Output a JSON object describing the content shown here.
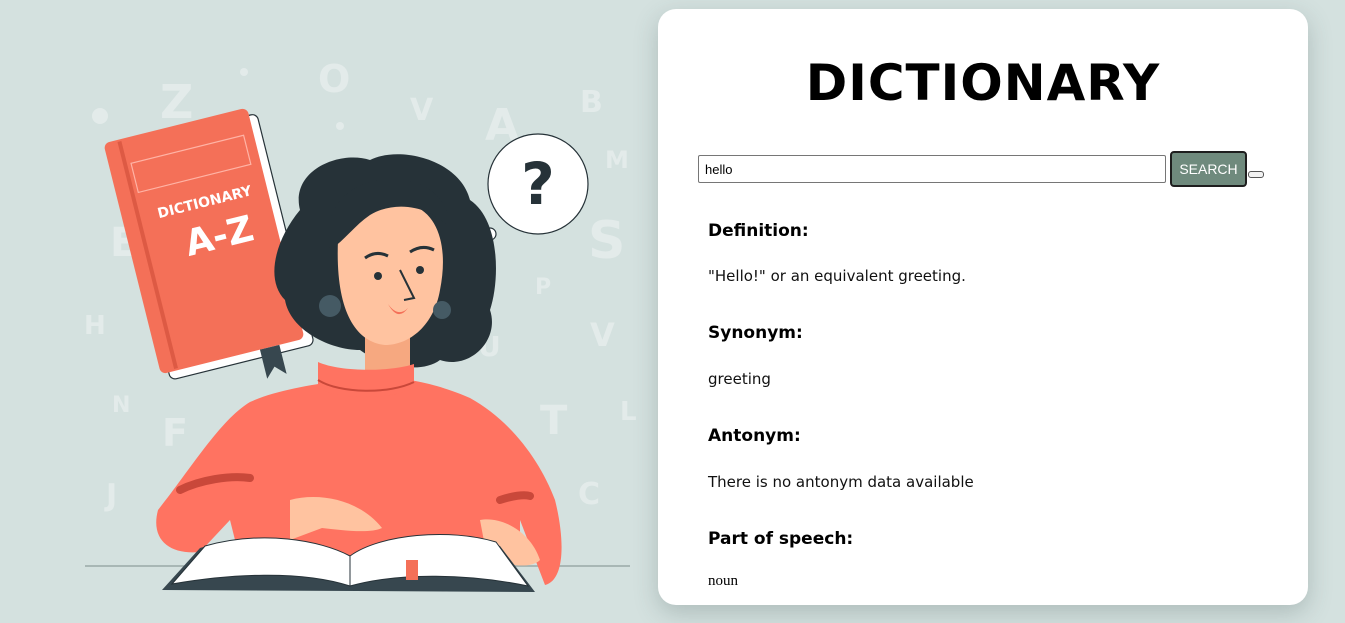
{
  "header": {
    "title": "DICTIONARY"
  },
  "search": {
    "value": "hello",
    "button_label": "SEARCH"
  },
  "results": {
    "definition": {
      "heading": "Definition:",
      "text": "\"Hello!\" or an equivalent greeting."
    },
    "synonym": {
      "heading": "Synonym:",
      "text": "greeting"
    },
    "antonym": {
      "heading": "Antonym:",
      "text": "There is no antonym data available"
    },
    "part_of_speech": {
      "heading": "Part of speech:",
      "text": "noun"
    }
  },
  "illustration": {
    "book_cover_line1": "DICTIONARY",
    "book_cover_line2": "A-Z",
    "thought_symbol": "?",
    "background_letters": [
      "Z",
      "O",
      "V",
      "A",
      "B",
      "M",
      "E",
      "S",
      "H",
      "P",
      "V",
      "N",
      "F",
      "T",
      "L",
      "J",
      "C",
      "U"
    ]
  },
  "colors": {
    "background": "#d4e1df",
    "card": "#ffffff",
    "button": "#6f8a7d",
    "book": "#f47058",
    "sweater": "#ff7361",
    "hair": "#263238",
    "skin": "#ffc3a0"
  }
}
